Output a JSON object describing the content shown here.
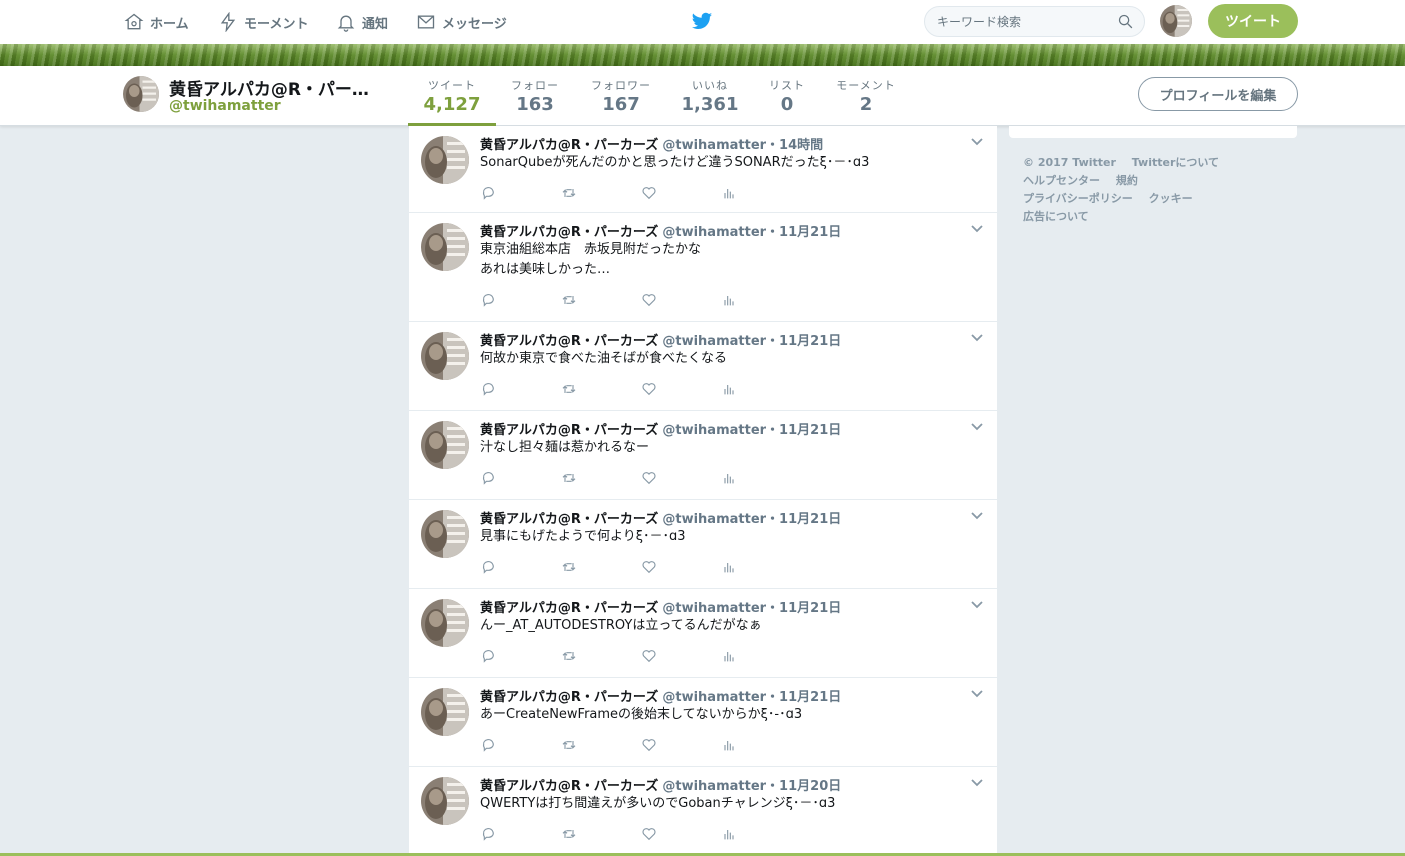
{
  "nav": {
    "home": "ホーム",
    "moments": "モーメント",
    "notifications": "通知",
    "messages": "メッセージ",
    "search_placeholder": "キーワード検索",
    "tweet_button": "ツイート"
  },
  "profile": {
    "name": "黄昏アルパカ@R・パー…",
    "handle": "@twihamatter",
    "stats": [
      {
        "label": "ツイート",
        "value": "4,127"
      },
      {
        "label": "フォロー",
        "value": "163"
      },
      {
        "label": "フォロワー",
        "value": "167"
      },
      {
        "label": "いいね",
        "value": "1,361"
      },
      {
        "label": "リスト",
        "value": "0"
      },
      {
        "label": "モーメント",
        "value": "2"
      }
    ],
    "edit_button": "プロフィールを編集"
  },
  "tweets": [
    {
      "name": "黄昏アルパカ@R・パーカーズ",
      "meta": "@twihamatter・14時間",
      "lines": [
        "SonarQubeが死んだのかと思ったけど違うSONARだったξ･－･ɑ3"
      ]
    },
    {
      "name": "黄昏アルパカ@R・パーカーズ",
      "meta": "@twihamatter・11月21日",
      "lines": [
        "東京油組総本店　赤坂見附だったかな",
        "あれは美味しかった…"
      ]
    },
    {
      "name": "黄昏アルパカ@R・パーカーズ",
      "meta": "@twihamatter・11月21日",
      "lines": [
        "何故か東京で食べた油そばが食べたくなる"
      ]
    },
    {
      "name": "黄昏アルパカ@R・パーカーズ",
      "meta": "@twihamatter・11月21日",
      "lines": [
        "汁なし担々麺は惹かれるなー"
      ]
    },
    {
      "name": "黄昏アルパカ@R・パーカーズ",
      "meta": "@twihamatter・11月21日",
      "lines": [
        "見事にもげたようで何よりξ･－･ɑ3"
      ]
    },
    {
      "name": "黄昏アルパカ@R・パーカーズ",
      "meta": "@twihamatter・11月21日",
      "lines": [
        "んー_AT_AUTODESTROYは立ってるんだがなぁ"
      ]
    },
    {
      "name": "黄昏アルパカ@R・パーカーズ",
      "meta": "@twihamatter・11月21日",
      "lines": [
        "あーCreateNewFrameの後始末してないからかξ･-･ɑ3"
      ]
    },
    {
      "name": "黄昏アルパカ@R・パーカーズ",
      "meta": "@twihamatter・11月20日",
      "lines": [
        "QWERTYは打ち間違えが多いのでGobanチャレンジξ･－･ɑ3"
      ]
    }
  ],
  "footer": {
    "copyright": "© 2017 Twitter",
    "about": "Twitterについて",
    "help": "ヘルプセンター",
    "terms": "規約",
    "privacy": "プライバシーポリシー",
    "cookies": "クッキー",
    "ads": "広告について"
  },
  "colors": {
    "accent": "#7ea03d",
    "button": "#9bbf5b",
    "twitter_blue": "#1da1f2"
  }
}
